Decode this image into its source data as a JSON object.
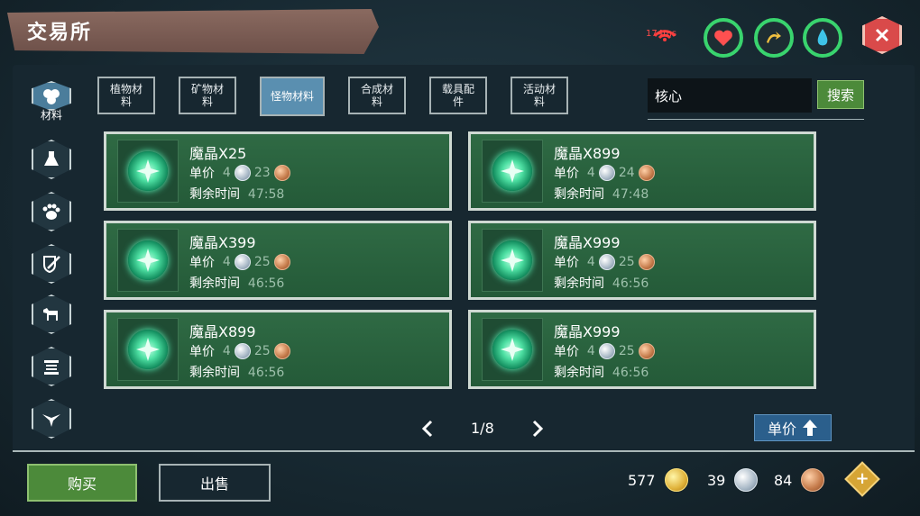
{
  "title": "交易所",
  "status": {
    "ping": "174ms"
  },
  "sidebar": {
    "items": [
      {
        "label": "材料",
        "icon": "materials-icon",
        "active": true
      },
      {
        "label": "",
        "icon": "potion-flask-icon",
        "active": false
      },
      {
        "label": "",
        "icon": "paw-icon",
        "active": false
      },
      {
        "label": "",
        "icon": "shield-sword-icon",
        "active": false
      },
      {
        "label": "",
        "icon": "horse-mount-icon",
        "active": false
      },
      {
        "label": "",
        "icon": "scroll-icon",
        "active": false
      },
      {
        "label": "",
        "icon": "bird-icon",
        "active": false
      }
    ]
  },
  "tabs": [
    {
      "label": "植物材料",
      "active": false
    },
    {
      "label": "矿物材料",
      "active": false
    },
    {
      "label": "怪物材料",
      "active": true
    },
    {
      "label": "合成材料",
      "active": false
    },
    {
      "label": "载具配件",
      "active": false
    },
    {
      "label": "活动材料",
      "active": false
    }
  ],
  "search": {
    "value": "核心",
    "button": "搜索"
  },
  "labels": {
    "unit_price": "单价",
    "time_left": "剩余时间"
  },
  "listings": [
    {
      "name": "魔晶X25",
      "silver": "4",
      "copper": "23",
      "time": "47:58"
    },
    {
      "name": "魔晶X899",
      "silver": "4",
      "copper": "24",
      "time": "47:48"
    },
    {
      "name": "魔晶X399",
      "silver": "4",
      "copper": "25",
      "time": "46:56"
    },
    {
      "name": "魔晶X999",
      "silver": "4",
      "copper": "25",
      "time": "46:56"
    },
    {
      "name": "魔晶X899",
      "silver": "4",
      "copper": "25",
      "time": "46:56"
    },
    {
      "name": "魔晶X999",
      "silver": "4",
      "copper": "25",
      "time": "46:56"
    }
  ],
  "pagination": {
    "text": "1/8"
  },
  "sort": {
    "label": "单价"
  },
  "actions": {
    "buy": "购买",
    "sell": "出售"
  },
  "currency": {
    "gold": "577",
    "silver": "39",
    "copper": "84"
  },
  "colors": {
    "card": "#2f6a44",
    "accent": "#4c8a3a",
    "close": "#d94a4a",
    "active_tab": "#5a8fb0"
  }
}
